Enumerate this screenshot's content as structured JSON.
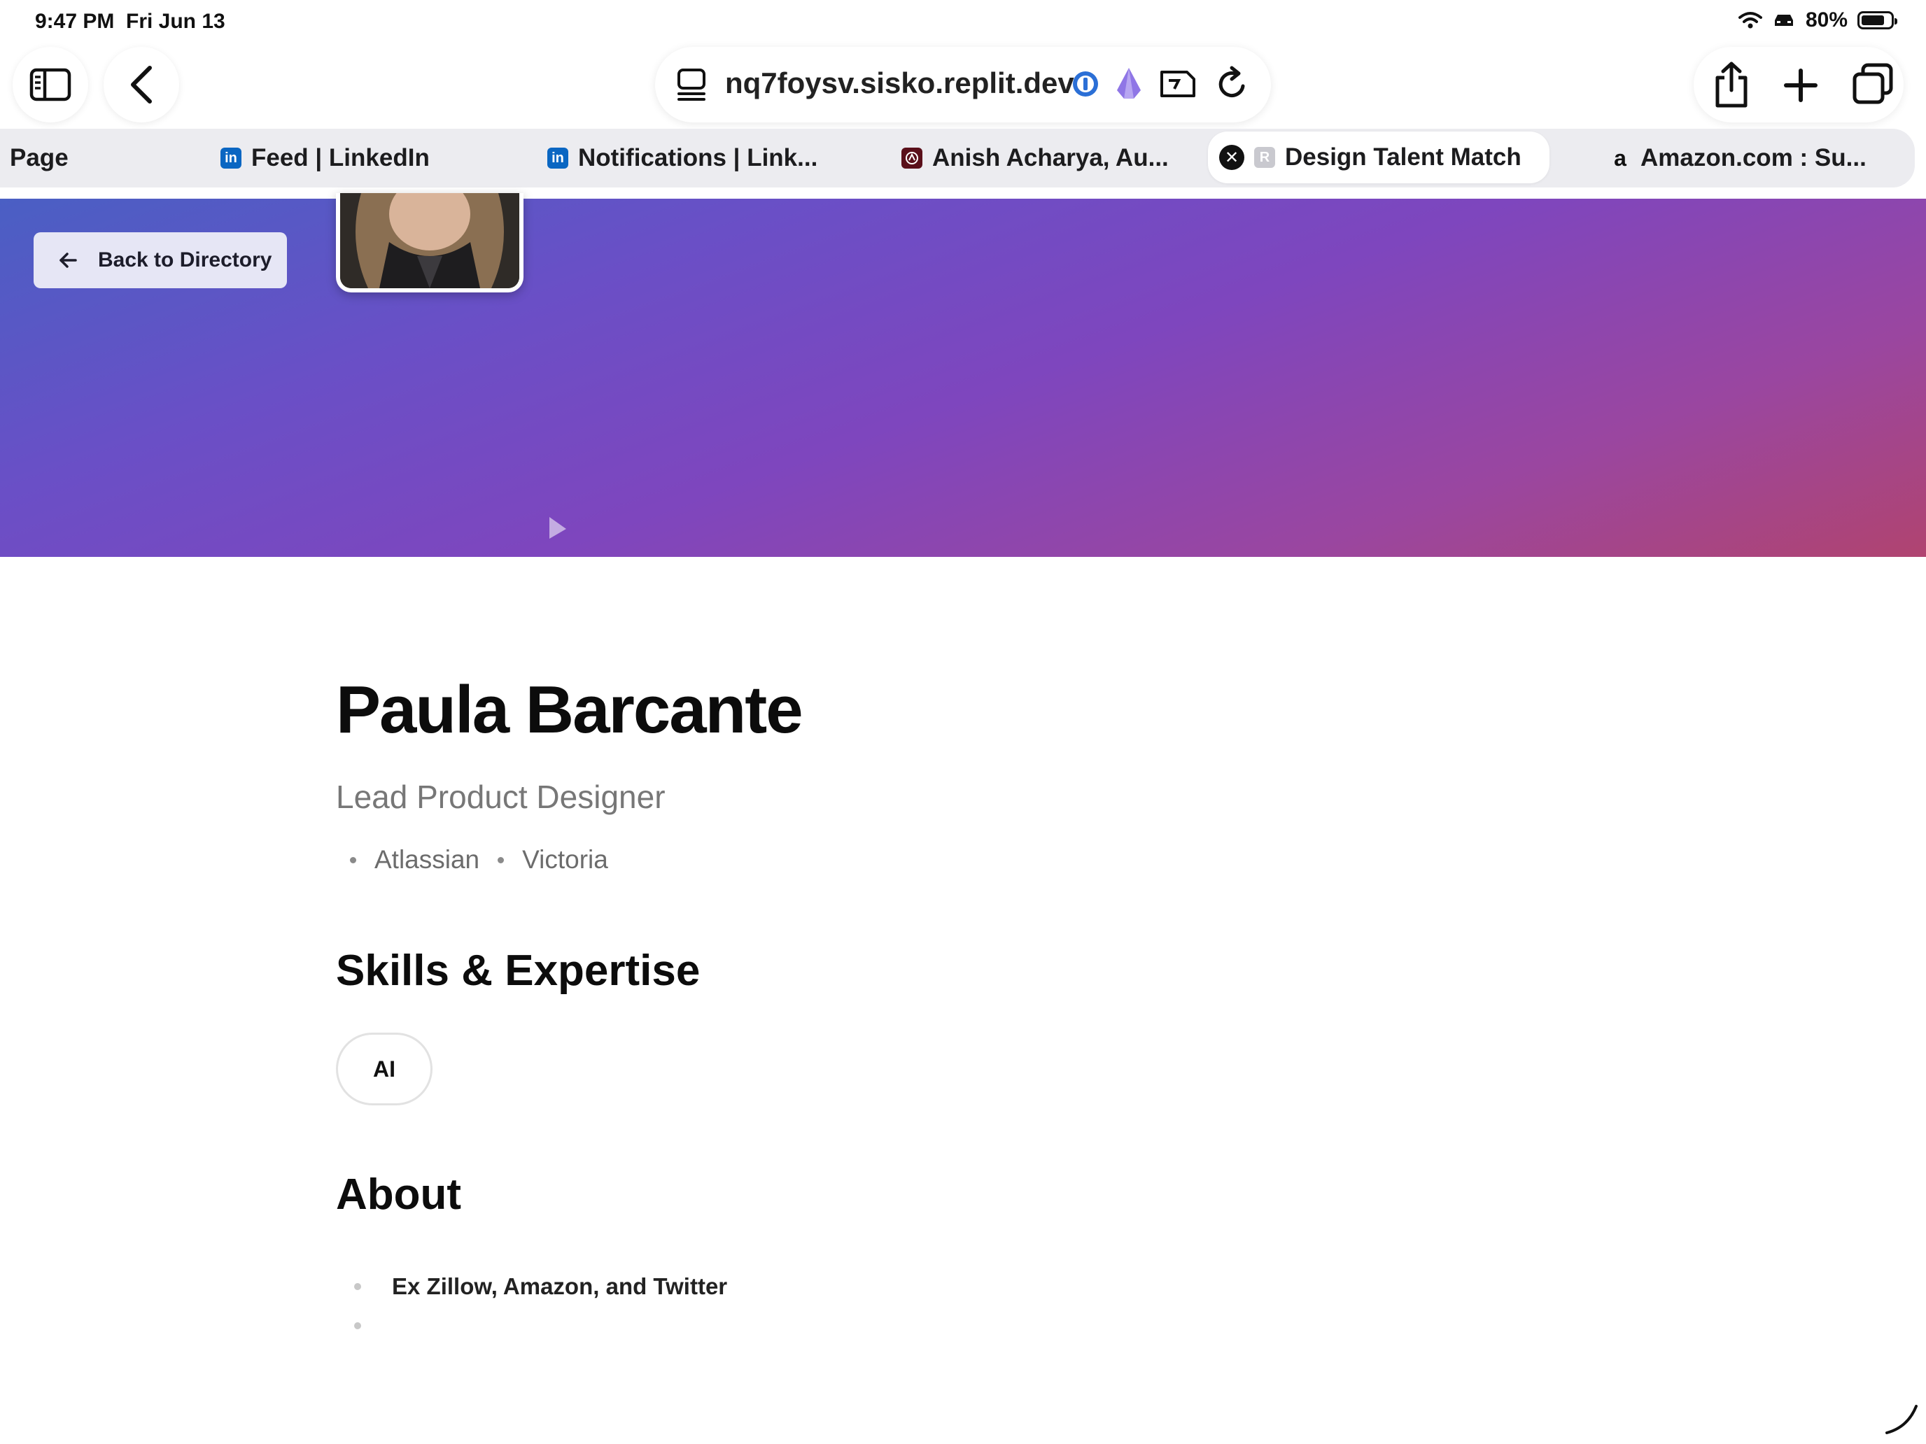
{
  "status_bar": {
    "time": "9:47 PM",
    "date": "Fri Jun 13",
    "battery": "80%",
    "battery_level": 0.8
  },
  "toolbar": {
    "url": "nq7foysv.sisko.replit.dev",
    "icons": [
      "sidebar-icon",
      "back-chevron-icon",
      "tab-overview-icon",
      "password-manager-icon",
      "extension-icon",
      "translate-icon",
      "reload-icon",
      "share-icon",
      "new-tab-icon",
      "tabs-icon"
    ]
  },
  "tabs": [
    {
      "label": "Page",
      "favicon": "none"
    },
    {
      "label": "Feed | LinkedIn",
      "favicon": "linkedin-icon"
    },
    {
      "label": "Notifications | Link...",
      "favicon": "linkedin-icon"
    },
    {
      "label": "Anish Acharya, Au...",
      "favicon": "site-icon"
    },
    {
      "label": "Design Talent Match",
      "favicon": "replit-icon",
      "favicon_letter": "R",
      "active": true
    },
    {
      "label": "Amazon.com : Su...",
      "favicon": "amazon-icon",
      "favicon_letter": "a"
    }
  ],
  "hero": {
    "back_label": "Back to Directory",
    "gradient_colors": [
      "#4a5fc4",
      "#7e46be",
      "#b04470"
    ]
  },
  "profile": {
    "name": "Paula Barcante",
    "title": "Lead Product Designer",
    "company": "Atlassian",
    "location": "Victoria"
  },
  "skills": {
    "heading": "Skills & Expertise",
    "items": [
      "AI"
    ]
  },
  "about": {
    "heading": "About",
    "items": [
      "Ex Zillow, Amazon, and Twitter",
      ""
    ]
  }
}
